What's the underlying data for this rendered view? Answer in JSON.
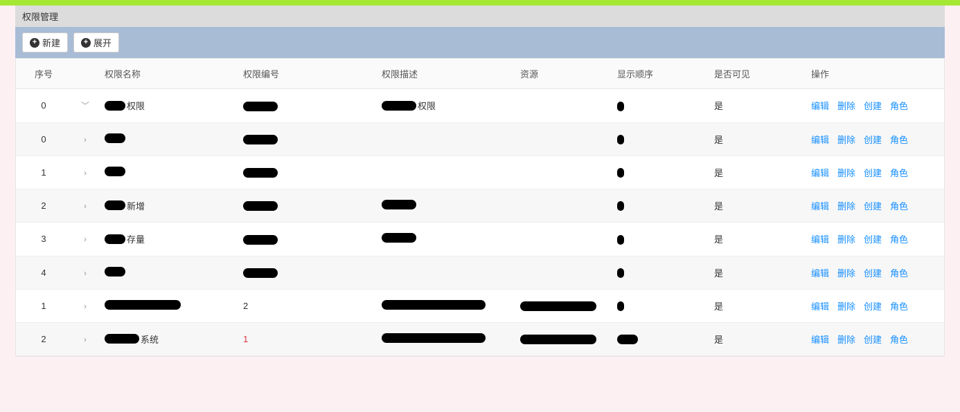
{
  "header": {
    "title": "权限管理"
  },
  "toolbar": {
    "new_label": "新建",
    "expand_label": "展开"
  },
  "columns": {
    "index": "序号",
    "name": "权限名称",
    "code": "权限编号",
    "desc": "权限描述",
    "resource": "资源",
    "order": "显示顺序",
    "visible": "是否可见",
    "actions": "操作"
  },
  "actions": {
    "edit": "编辑",
    "delete": "删除",
    "create": "创建",
    "role": "角色"
  },
  "rows": [
    {
      "index": "0",
      "expanded": true,
      "name_suffix": "权限",
      "desc_suffix": "权限",
      "visible": "是"
    },
    {
      "index": "0",
      "expanded": false,
      "name_suffix": "",
      "desc_suffix": "",
      "visible": "是"
    },
    {
      "index": "1",
      "expanded": false,
      "name_suffix": "",
      "desc_suffix": "",
      "visible": "是"
    },
    {
      "index": "2",
      "expanded": false,
      "name_suffix": "新增",
      "desc_suffix": "",
      "visible": "是"
    },
    {
      "index": "3",
      "expanded": false,
      "name_suffix": "存量",
      "desc_suffix": "",
      "visible": "是"
    },
    {
      "index": "4",
      "expanded": false,
      "name_suffix": "",
      "desc_suffix": "",
      "visible": "是"
    },
    {
      "index": "1",
      "expanded": false,
      "name_suffix": "",
      "desc_suffix": "",
      "visible": "是",
      "code_plain": "2"
    },
    {
      "index": "2",
      "expanded": false,
      "name_suffix": "系统",
      "desc_suffix": "",
      "visible": "是",
      "code_plain": "1",
      "code_plain_class": "red-text"
    }
  ]
}
